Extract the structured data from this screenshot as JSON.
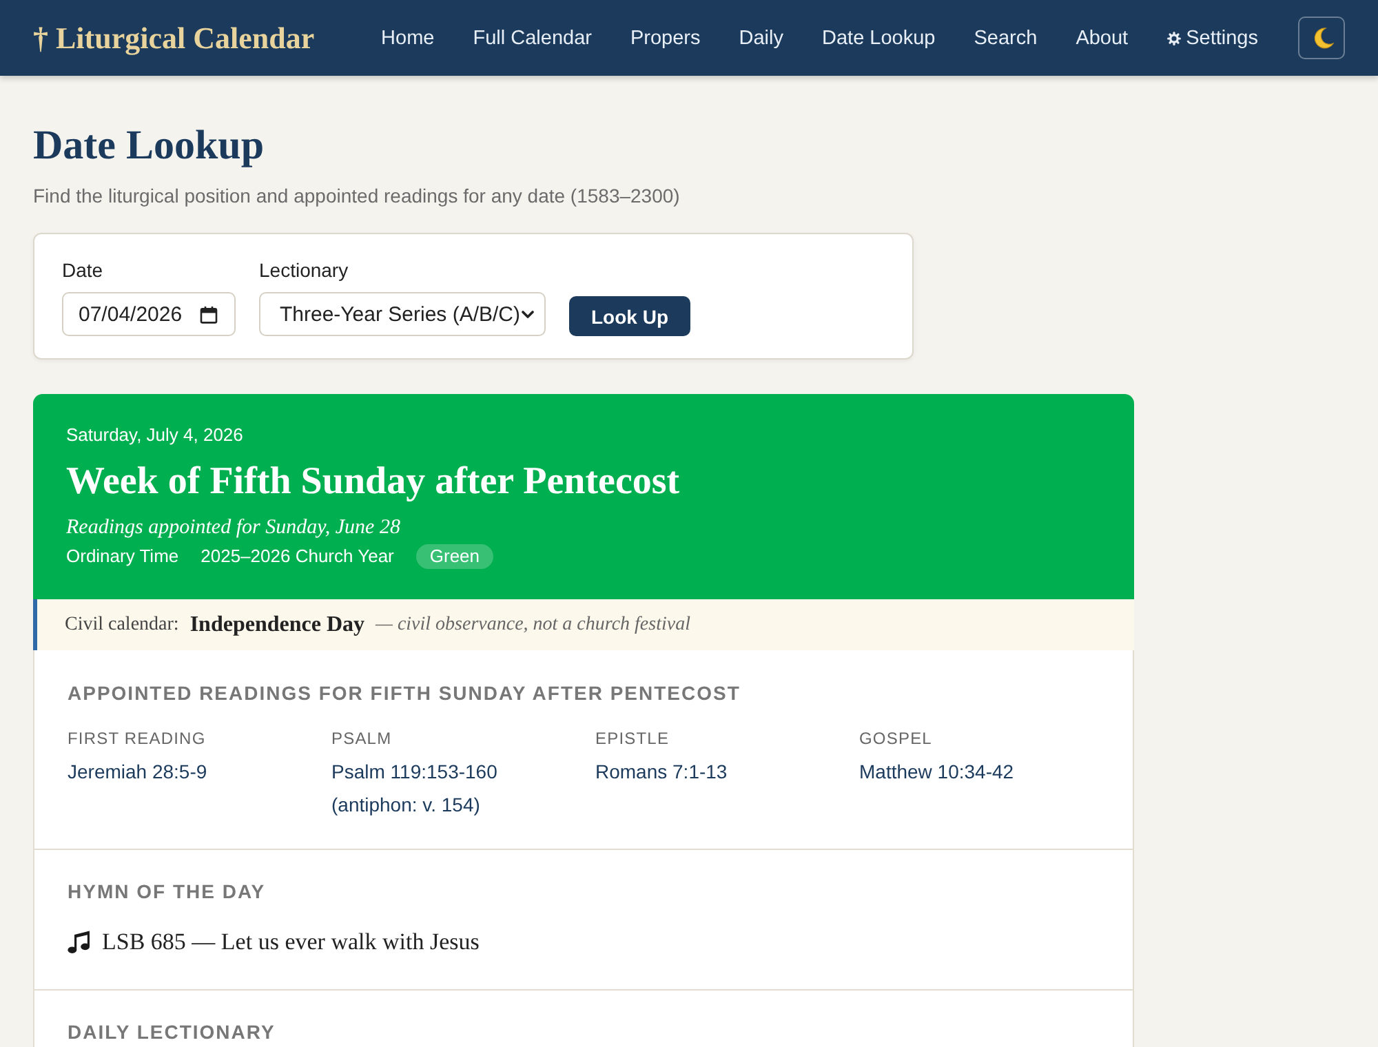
{
  "header": {
    "logo": "† Liturgical Calendar",
    "nav": [
      {
        "label": "Home",
        "kind": "link"
      },
      {
        "label": "Full Calendar",
        "kind": "link"
      },
      {
        "label": "Propers",
        "kind": "link"
      },
      {
        "label": "Daily",
        "kind": "link"
      },
      {
        "label": "Date Lookup",
        "kind": "link"
      },
      {
        "label": "Search",
        "kind": "link"
      },
      {
        "label": "About",
        "kind": "link"
      },
      {
        "label": "Settings",
        "kind": "settings_link"
      }
    ]
  },
  "page": {
    "title": "Date Lookup",
    "subtitle": "Find the liturgical position and appointed readings for any date (1583–2300)"
  },
  "form": {
    "date_label": "Date",
    "date_value": "07/04/2026",
    "lectionary_label": "Lectionary",
    "lectionary_value": "Three-Year Series (A/B/C)",
    "submit": "Look Up"
  },
  "result": {
    "date": "Saturday, July 4, 2026",
    "title": "Week of Fifth Sunday after Pentecost",
    "note": "Readings appointed for Sunday, June 28",
    "season": "Ordinary Time",
    "church_year": "2025–2026 Church Year",
    "color_badge": "Green"
  },
  "civil": {
    "label": "Civil calendar:",
    "name": "Independence Day",
    "note": "— civil observance, not a church festival"
  },
  "sections": [
    {
      "kind": "readings",
      "heading": "APPOINTED READINGS FOR FIFTH SUNDAY AFTER PENTECOST",
      "readings": [
        {
          "label": "FIRST READING",
          "text": "Jeremiah 28:5-9"
        },
        {
          "label": "PSALM",
          "text": "Psalm 119:153-160",
          "antiphon": "(antiphon: v. 154)"
        },
        {
          "label": "EPISTLE",
          "text": "Romans 7:1-13"
        },
        {
          "label": "GOSPEL",
          "text": "Matthew 10:34-42"
        }
      ]
    },
    {
      "kind": "hymn",
      "heading": "HYMN OF THE DAY",
      "text": "LSB 685 — Let us ever walk with Jesus"
    },
    {
      "kind": "daily",
      "heading": "DAILY LECTIONARY"
    }
  ]
}
